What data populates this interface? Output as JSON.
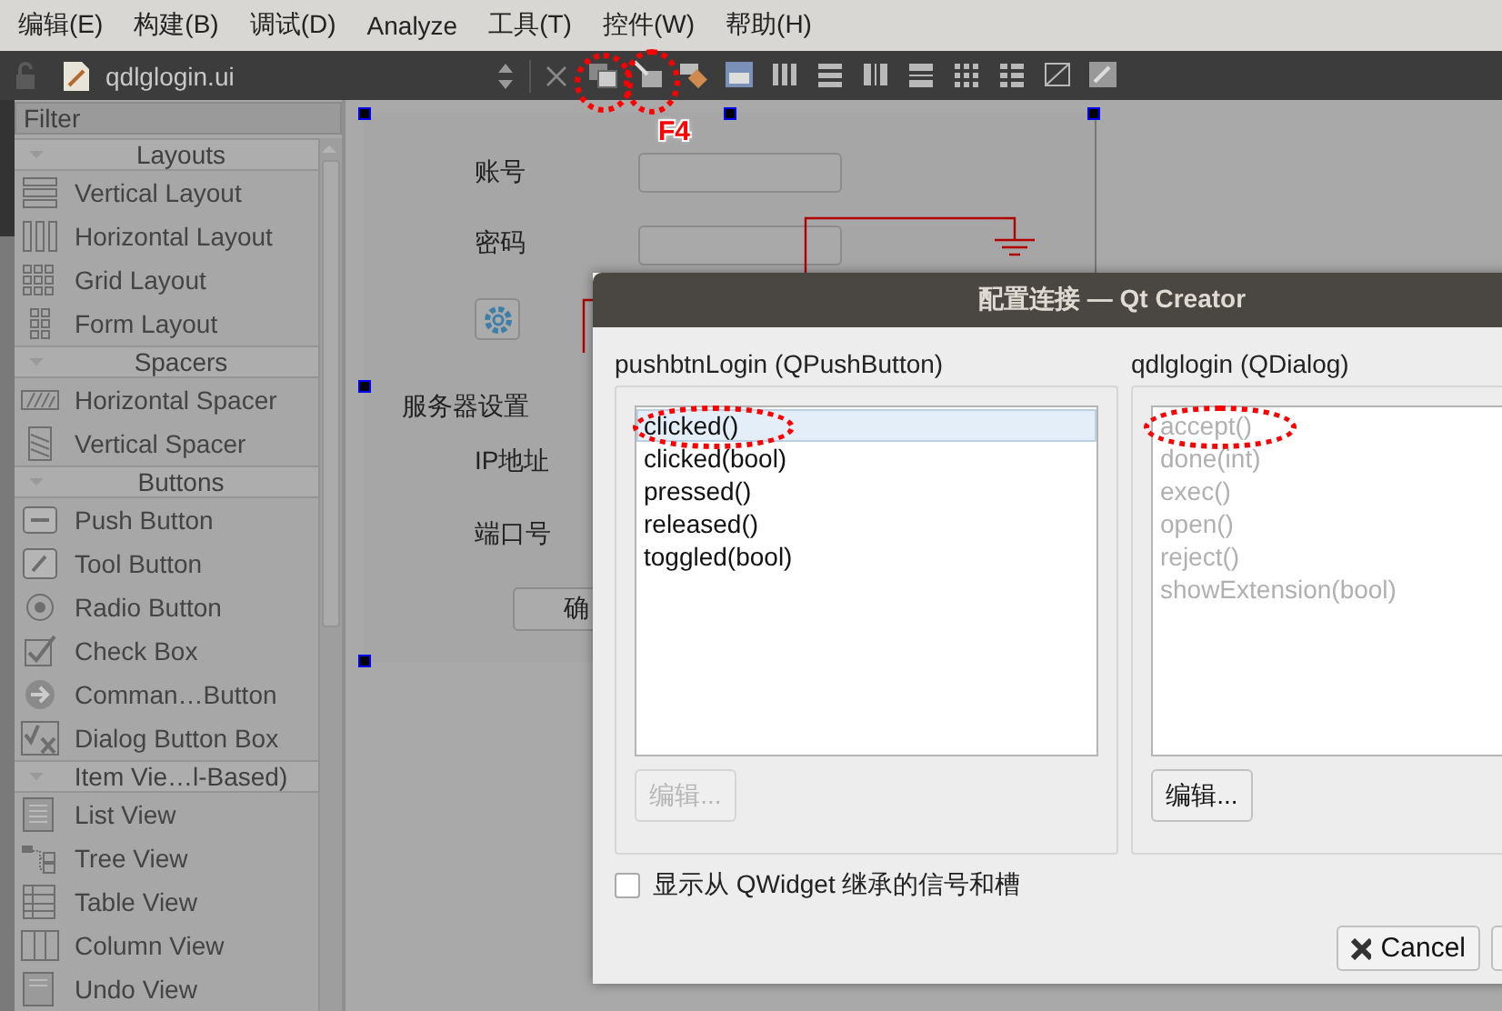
{
  "menu_bar": [
    {
      "label": "编辑(E)"
    },
    {
      "label": "构建(B)"
    },
    {
      "label": "调试(D)"
    },
    {
      "label": "Analyze"
    },
    {
      "label": "工具(T)"
    },
    {
      "label": "控件(W)"
    },
    {
      "label": "帮助(H)"
    }
  ],
  "editor_tab": {
    "file_name": "qdlglogin.ui"
  },
  "widget_box": {
    "filter": {
      "placeholder": "Filter"
    },
    "categories": [
      {
        "title": "Layouts",
        "expanded": true,
        "items": [
          {
            "label": "Vertical Layout"
          },
          {
            "label": "Horizontal Layout"
          },
          {
            "label": "Grid Layout"
          },
          {
            "label": "Form Layout"
          }
        ]
      },
      {
        "title": "Spacers",
        "expanded": true,
        "items": [
          {
            "label": "Horizontal Spacer"
          },
          {
            "label": "Vertical Spacer"
          }
        ]
      },
      {
        "title": "Buttons",
        "expanded": true,
        "items": [
          {
            "label": "Push Button"
          },
          {
            "label": "Tool Button"
          },
          {
            "label": "Radio Button"
          },
          {
            "label": "Check Box"
          },
          {
            "label": "Comman…Button"
          },
          {
            "label": "Dialog Button Box"
          }
        ]
      },
      {
        "title": "Item Vie…l-Based)",
        "expanded": true,
        "items": [
          {
            "label": "List View"
          },
          {
            "label": "Tree View"
          },
          {
            "label": "Table View"
          },
          {
            "label": "Column View"
          },
          {
            "label": "Undo View"
          }
        ]
      }
    ]
  },
  "form": {
    "account_label": "账号",
    "password_label": "密码",
    "server_group_title": "服务器设置",
    "ip_label": "IP地址",
    "port_label": "端口号",
    "confirm_button": "确"
  },
  "annotations": {
    "shortcut_label": "F4"
  },
  "dialog": {
    "title": "配置连接 — Qt Creator",
    "signal_panel": {
      "title": "pushbtnLogin (QPushButton)",
      "items": [
        {
          "label": "clicked()",
          "selected": true,
          "disabled": false
        },
        {
          "label": "clicked(bool)",
          "selected": false,
          "disabled": false
        },
        {
          "label": "pressed()",
          "selected": false,
          "disabled": false
        },
        {
          "label": "released()",
          "selected": false,
          "disabled": false
        },
        {
          "label": "toggled(bool)",
          "selected": false,
          "disabled": false
        }
      ],
      "edit_button": {
        "label": "编辑...",
        "disabled": true
      }
    },
    "slot_panel": {
      "title": "qdlglogin (QDialog)",
      "items": [
        {
          "label": "accept()",
          "selected": false,
          "disabled": true
        },
        {
          "label": "done(int)",
          "selected": false,
          "disabled": true
        },
        {
          "label": "exec()",
          "selected": false,
          "disabled": true
        },
        {
          "label": "open()",
          "selected": false,
          "disabled": true
        },
        {
          "label": "reject()",
          "selected": false,
          "disabled": true
        },
        {
          "label": "showExtension(bool)",
          "selected": false,
          "disabled": true
        }
      ],
      "edit_button": {
        "label": "编辑...",
        "disabled": false
      }
    },
    "inherited_checkbox": {
      "label": "显示从 QWidget 继承的信号和槽",
      "checked": false
    },
    "buttons": [
      {
        "label": "Cancel",
        "kind": "cancel"
      },
      {
        "kind": "partial"
      }
    ]
  }
}
